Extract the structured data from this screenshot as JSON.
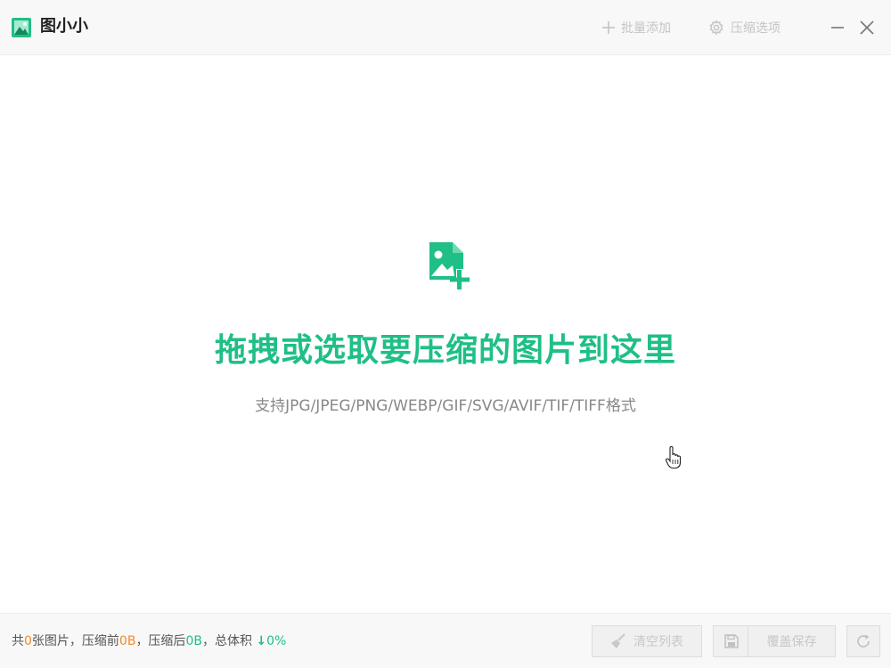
{
  "window": {
    "title": "图小小",
    "controls": {
      "minimize_icon": "minimize-icon",
      "close_icon": "close-icon"
    }
  },
  "toolbar": {
    "batch_add_label": "批量添加",
    "batch_add_icon": "plus-icon",
    "compress_options_label": "压缩选项",
    "compress_options_icon": "gear-icon"
  },
  "dropzone": {
    "icon": "image-add-icon",
    "heading": "拖拽或选取要压缩的图片到这里",
    "formats_text": "支持JPG/JPEG/PNG/WEBP/GIF/SVG/AVIF/TIF/TIFF格式"
  },
  "footer": {
    "stats": {
      "prefix": "共",
      "count": "0",
      "count_suffix": "张图片，压缩前",
      "before_size": "0B",
      "after_prefix": "，压缩后",
      "after_size": "0B",
      "total_prefix": "，总体积",
      "arrow": "↓",
      "ratio": "0%"
    },
    "buttons": {
      "clear_list_label": "清空列表",
      "overwrite_save_label": "覆盖保存"
    }
  },
  "colors": {
    "accent": "#1fbf86",
    "orange": "#f08a2c",
    "disabled_text": "#c8c8c8"
  }
}
